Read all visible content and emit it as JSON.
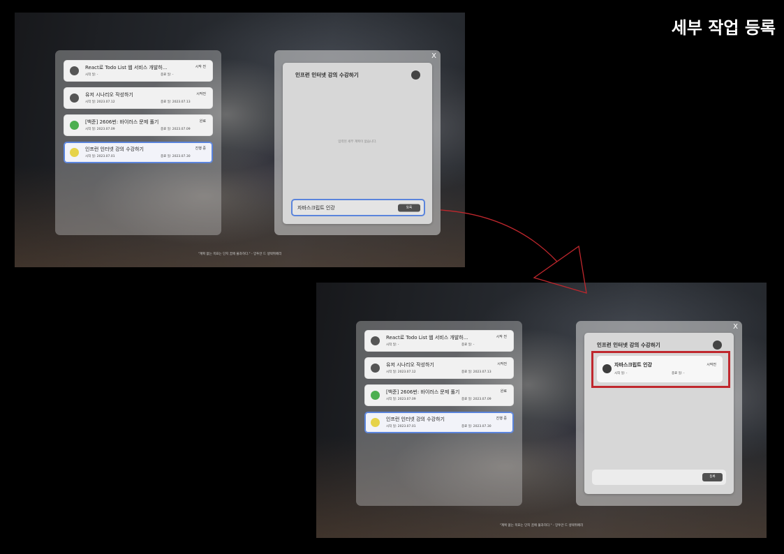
{
  "page_title": "세부 작업 등록",
  "colors": {
    "accent_blue": "#5a84dc",
    "annotation_red": "#c0272d"
  },
  "screens": [
    {
      "tasks": [
        {
          "title": "React로 Todo List 웹 서비스 개발하...",
          "status": "시작 전",
          "start": "시작 일: -",
          "end": "종료 일: -",
          "color": "#555555",
          "selected": false
        },
        {
          "title": "유저 시나리오 작성하기",
          "status": "시작전",
          "start": "시작 일: 2023.07.12",
          "end": "종료 일: 2023.07.13",
          "color": "#555555",
          "selected": false
        },
        {
          "title": "[백준] 2606번: 바이러스 문제 풀기",
          "status": "완료",
          "start": "시작 일: 2023.07.09",
          "end": "종료 일: 2023.07.09",
          "color": "#4caf50",
          "selected": false
        },
        {
          "title": "인프런 인터넷 강의 수강하기",
          "status": "진행 중",
          "start": "시작 일: 2023.07.01",
          "end": "종료 일: 2023.07.30",
          "color": "#e6d34a",
          "selected": true
        }
      ],
      "detail": {
        "close": "X",
        "title": "인프런 인터넷 강의 수강하기",
        "status_color": "#444444",
        "empty_text": "입력된 세부 계획이 없습니다.",
        "input_value": "자바스크립트 인강",
        "submit_label": "등록"
      },
      "quote": "\"계획 없는 목표는 단지 꿈에 불과하다.\" - 앙투안 드 생텍쥐페리"
    },
    {
      "tasks": [
        {
          "title": "React로 Todo List 웹 서비스 개발하...",
          "status": "시작 전",
          "start": "시작 일: -",
          "end": "종료 일: -",
          "color": "#555555",
          "selected": false
        },
        {
          "title": "유저 시나리오 작성하기",
          "status": "시작전",
          "start": "시작 일: 2023.07.12",
          "end": "종료 일: 2023.07.13",
          "color": "#555555",
          "selected": false
        },
        {
          "title": "[백준] 2606번: 바이러스 문제 풀기",
          "status": "완료",
          "start": "시작 일: 2023.07.09",
          "end": "종료 일: 2023.07.09",
          "color": "#4caf50",
          "selected": false
        },
        {
          "title": "인프런 인터넷 강의 수강하기",
          "status": "진행 중",
          "start": "시작 일: 2023.07.01",
          "end": "종료 일: 2023.07.30",
          "color": "#e6d34a",
          "selected": true
        }
      ],
      "detail": {
        "close": "X",
        "title": "인프런 인터넷 강의 수강하기",
        "status_color": "#444444",
        "subtasks": [
          {
            "title": "자바스크립트 인강",
            "status": "시작전",
            "start": "시작 일: -",
            "end": "종료 일: -",
            "color": "#3d3d3d"
          }
        ],
        "input_value": "",
        "submit_label": "등록"
      },
      "quote": "\"계획 없는 목표는 단지 꿈에 불과하다.\" - 앙투안 드 생텍쥐페리"
    }
  ]
}
